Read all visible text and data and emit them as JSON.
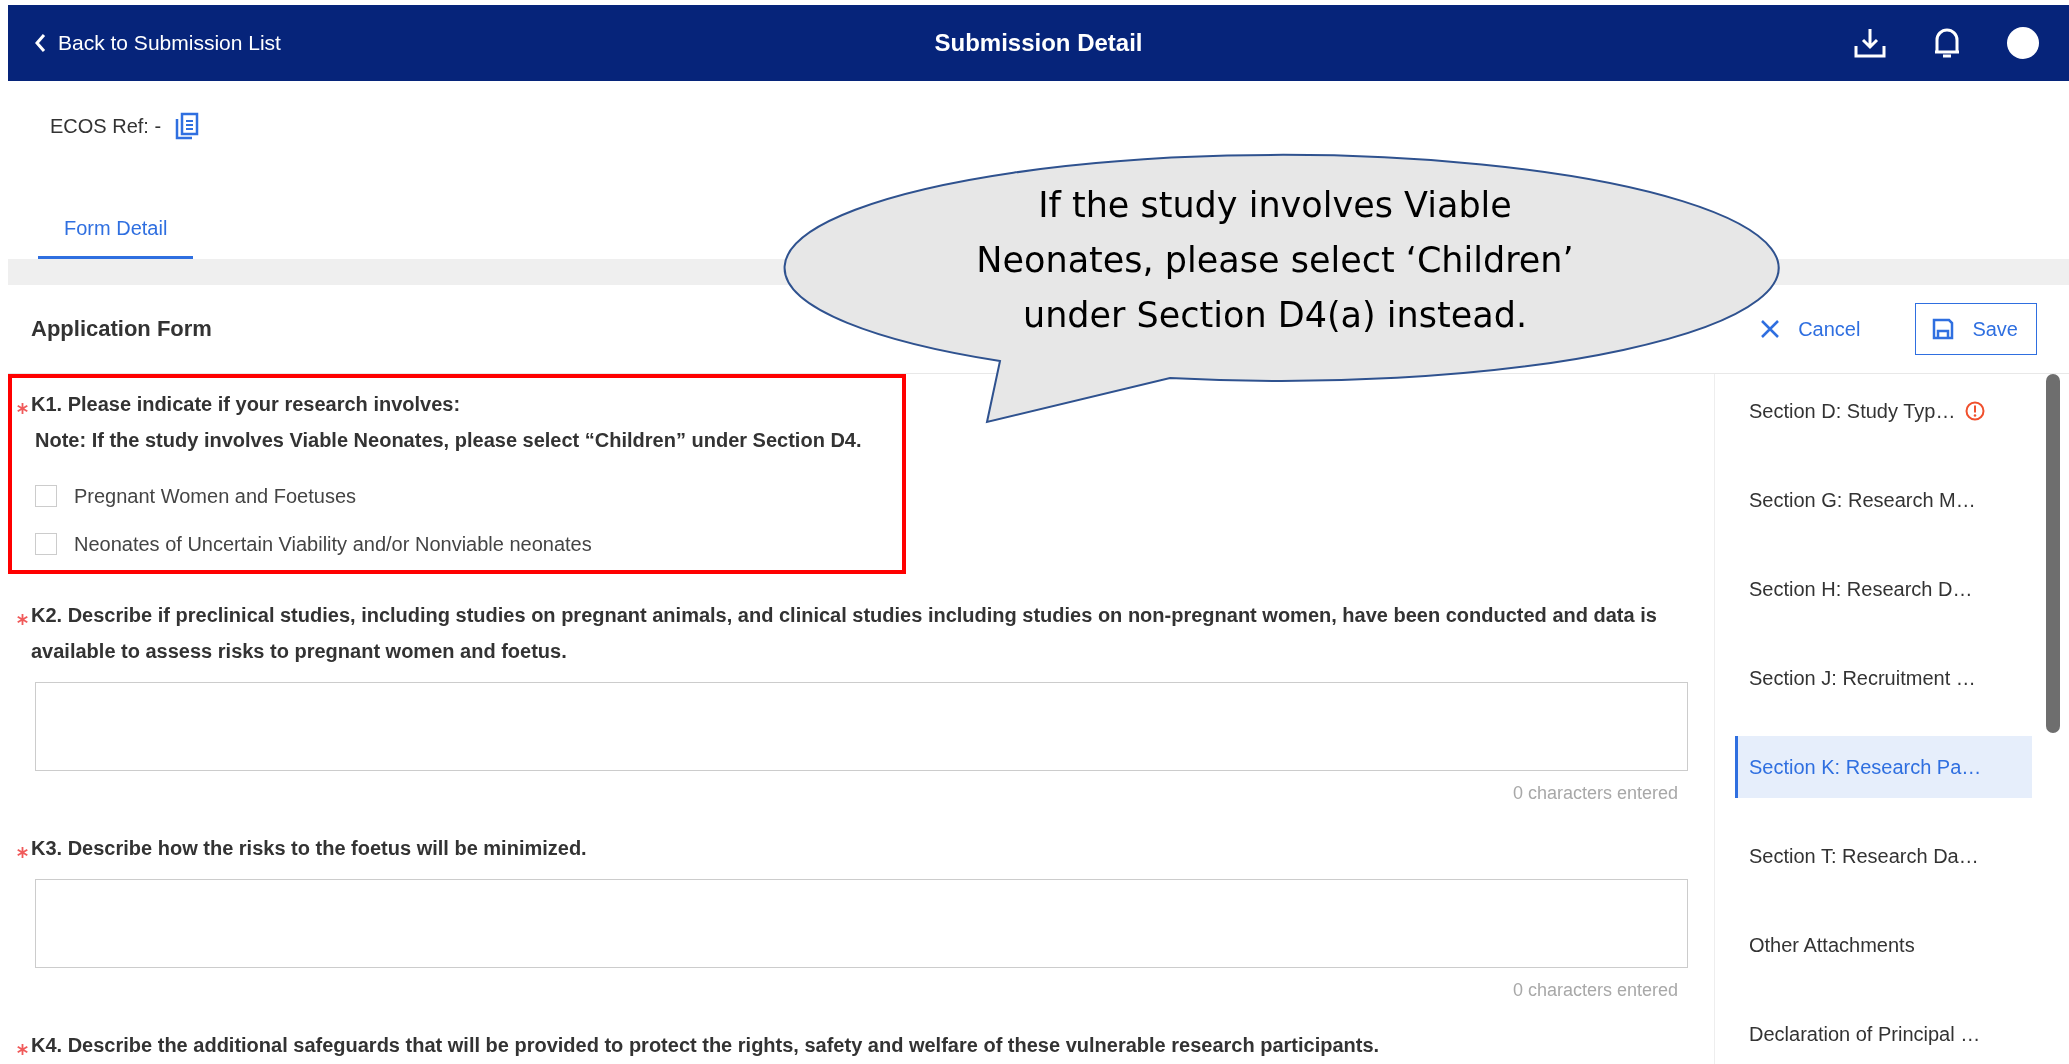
{
  "header": {
    "back_link": "Back to Submission List",
    "title": "Submission Detail"
  },
  "reference": {
    "label": "ECOS Ref: -"
  },
  "tabs": [
    {
      "label": "Form Detail",
      "selected": true
    }
  ],
  "form": {
    "title": "Application Form",
    "actions": [
      {
        "kind": "cancel",
        "label": "Cancel"
      },
      {
        "kind": "save",
        "label": "Save"
      }
    ]
  },
  "questions": [
    {
      "kind": "checkboxes",
      "required": true,
      "highlighted": true,
      "label": "K1. Please indicate if your research involves:",
      "note": "Note: If the study involves Viable Neonates, please select “Children” under Section D4.",
      "options": [
        {
          "label": "Pregnant Women and Foetuses",
          "checked": false
        },
        {
          "label": "Neonates of Uncertain Viability and/or Nonviable neonates",
          "checked": false
        }
      ]
    },
    {
      "kind": "textarea",
      "required": true,
      "highlighted": false,
      "label": "K2. Describe if preclinical studies, including studies on pregnant animals, and clinical studies including studies on non-pregnant women, have been conducted and data is available to assess risks to pregnant women and foetus.",
      "counter": "0 characters entered"
    },
    {
      "kind": "textarea",
      "required": true,
      "highlighted": false,
      "label": "K3. Describe how the risks to the foetus will be minimized.",
      "counter": "0 characters entered"
    },
    {
      "kind": "label-only",
      "required": true,
      "highlighted": false,
      "label": "K4. Describe the additional safeguards that will be provided to protect the rights, safety and welfare of these vulnerable research participants."
    }
  ],
  "sections": [
    {
      "label": "Section D: Study Typ…",
      "selected": false,
      "warning": true
    },
    {
      "label": "Section G: Research M…",
      "selected": false,
      "warning": false
    },
    {
      "label": "Section H: Research D…",
      "selected": false,
      "warning": false
    },
    {
      "label": "Section J: Recruitment …",
      "selected": false,
      "warning": false
    },
    {
      "label": "Section K: Research Pa…",
      "selected": true,
      "warning": false
    },
    {
      "label": "Section T: Research Da…",
      "selected": false,
      "warning": false
    },
    {
      "label": "Other Attachments",
      "selected": false,
      "warning": false
    },
    {
      "label": "Declaration of Principal …",
      "selected": false,
      "warning": false
    }
  ],
  "callout": {
    "text": "If the study involves Viable Neonates, please select ‘Children’ under Section D4(a) instead."
  }
}
